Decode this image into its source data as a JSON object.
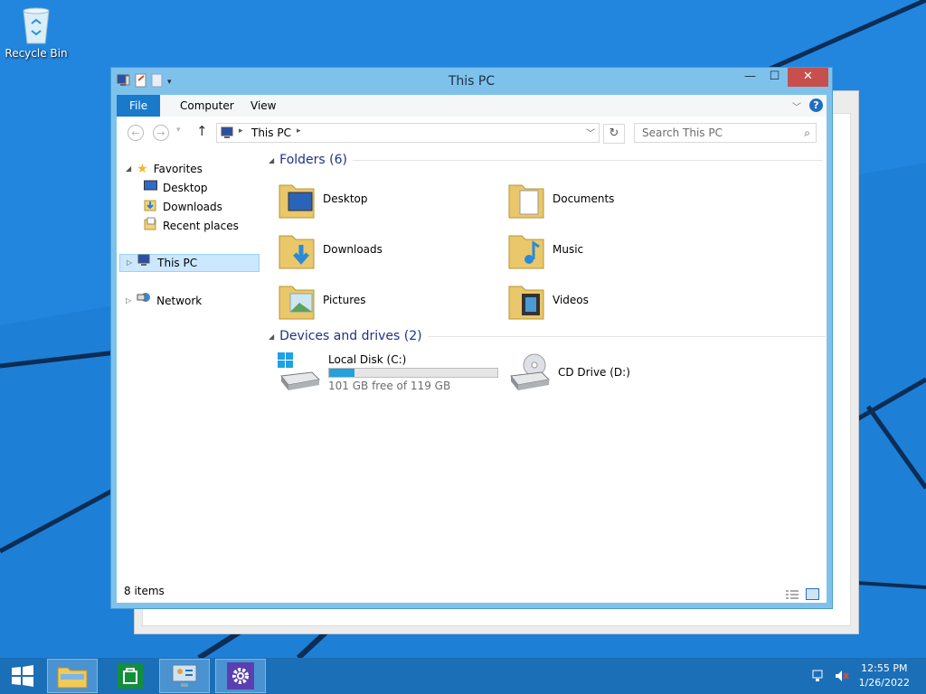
{
  "desktop": {
    "icons": [
      {
        "label": "Recycle Bin",
        "icon": "recycle-bin-icon"
      }
    ]
  },
  "window": {
    "title": "This PC",
    "controls": {
      "minimize": "—",
      "maximize": "☐",
      "close": "✕"
    },
    "ribbon_tabs": [
      "File",
      "Computer",
      "View"
    ],
    "address": {
      "path": "This PC"
    },
    "search": {
      "placeholder": "Search This PC"
    }
  },
  "nav_pane": {
    "favorites": {
      "label": "Favorites",
      "items": [
        "Desktop",
        "Downloads",
        "Recent places"
      ]
    },
    "this_pc": "This PC",
    "network": "Network"
  },
  "main": {
    "folders_group": {
      "label": "Folders (6)",
      "items": [
        "Desktop",
        "Documents",
        "Downloads",
        "Music",
        "Pictures",
        "Videos"
      ]
    },
    "devices_group": {
      "label": "Devices and drives (2)",
      "drives": [
        {
          "name": "Local Disk (C:)",
          "free_text": "101 GB free of 119 GB",
          "used_fraction": 0.15
        },
        {
          "name": "CD Drive (D:)"
        }
      ]
    }
  },
  "status": {
    "items_count": "8 items"
  },
  "taskbar": {
    "buttons": [
      "start-button",
      "file-explorer",
      "store",
      "control-panel",
      "settings"
    ],
    "clock": {
      "time": "12:55 PM",
      "date": "1/26/2022"
    }
  },
  "colors": {
    "accent": "#1979ca",
    "desktop": "#1e7fd6",
    "taskbar": "#1b6fb7",
    "title_bar": "#7ec2ec",
    "close": "#c7504d",
    "drive_bar": "#26a0da"
  }
}
